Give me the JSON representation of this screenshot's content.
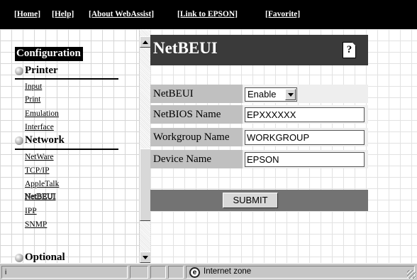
{
  "top_nav": {
    "links": [
      "[Home]",
      "[Help]",
      "[About WebAssist]",
      "[Link to EPSON]",
      "[Favorite]"
    ]
  },
  "sidebar": {
    "title": "Configuration",
    "sections": [
      {
        "label": "Printer",
        "items": [
          "Input",
          "Print",
          "Emulation",
          "Interface"
        ]
      },
      {
        "label": "Network",
        "items": [
          "NetWare",
          "TCP/IP",
          "AppleTalk",
          "NetBEUI",
          "IPP",
          "SNMP"
        ]
      },
      {
        "label": "Optional",
        "items": []
      }
    ],
    "current_item": "NetBEUI"
  },
  "main": {
    "heading": "NetBEUI",
    "help_icon": "?",
    "form": {
      "netbeui_label": "NetBEUI",
      "netbeui_value": "Enable",
      "netbios_label": "NetBIOS Name",
      "netbios_value": "EPXXXXXX",
      "workgroup_label": "Workgroup Name",
      "workgroup_value": "WORKGROUP",
      "device_label": "Device Name",
      "device_value": "EPSON"
    },
    "submit_label": "SUBMIT"
  },
  "status": {
    "zone_text": "Internet zone",
    "left_icon": "i"
  },
  "colors": {
    "topbar": "#000000",
    "heading_bar": "#3a3a3a",
    "label_cell": "#c0c0c0",
    "submit_bar": "#737373"
  },
  "icons": [
    "help-icon",
    "internet-explorer-icon",
    "scroll-up-arrow-icon",
    "scroll-down-arrow-icon",
    "dropdown-arrow-icon",
    "resize-grip-icon",
    "section-bullet-icon"
  ]
}
